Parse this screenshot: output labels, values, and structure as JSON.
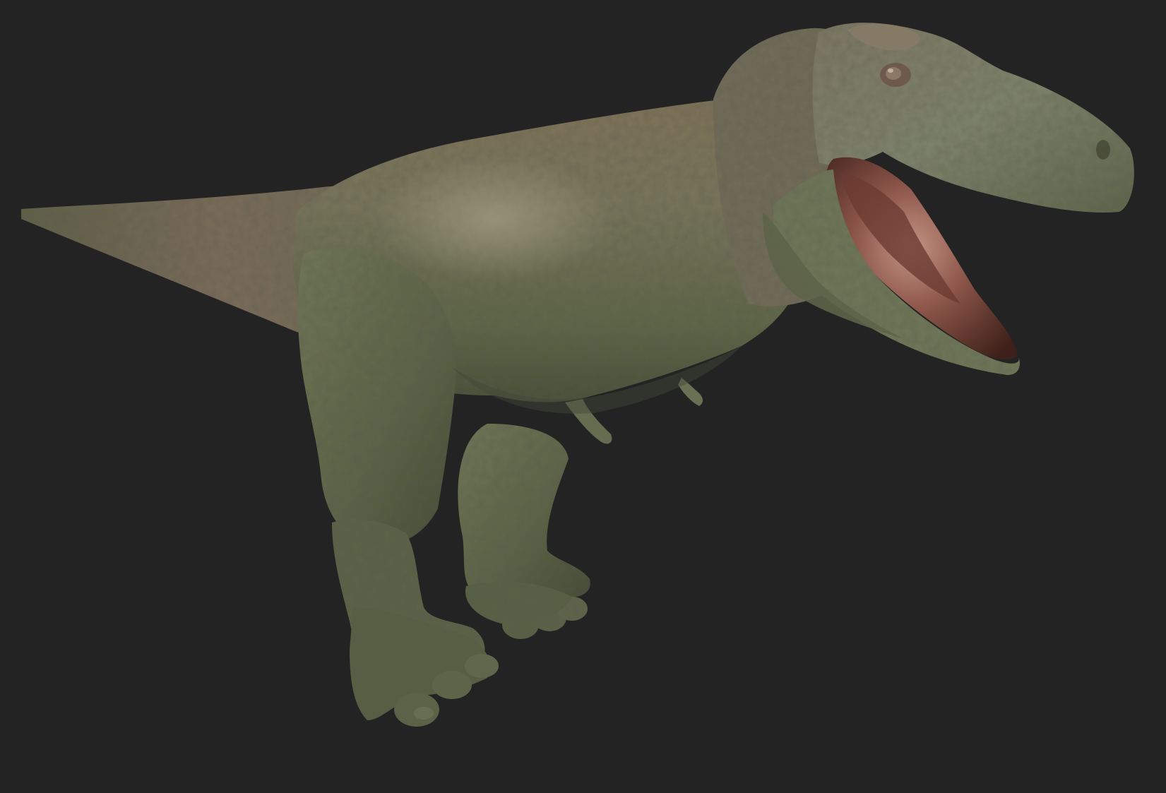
{
  "scene": {
    "background_color": "#232323",
    "subject": "t-rex-3d-model-render",
    "colors": {
      "skin_dark": "#4b5139",
      "skin_mid": "#6a7052",
      "skin_light": "#8f9474",
      "skin_warm": "#7b6a55",
      "highlight": "#b3b398",
      "mouth_dark": "#4a2a22",
      "mouth_flesh": "#8a5448",
      "mouth_highlight": "#c49484",
      "eye": "#8d7868"
    }
  }
}
